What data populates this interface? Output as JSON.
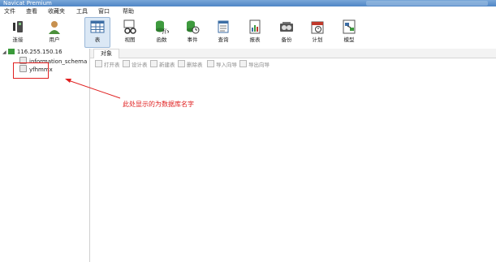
{
  "window": {
    "title": "Navicat Premium"
  },
  "menu": [
    "文件",
    "查看",
    "收藏夹",
    "工具",
    "窗口",
    "帮助"
  ],
  "toolbar": {
    "connect": "连接",
    "user": "用户",
    "table": "表",
    "view": "视图",
    "function": "函数",
    "event": "事件",
    "query": "查询",
    "report": "报表",
    "backup": "备份",
    "schedule": "计划",
    "model": "模型"
  },
  "tree": {
    "connection": "116.255.150.16",
    "databases": [
      "information_schema",
      "yfhmmx"
    ]
  },
  "tab": {
    "label": "对象"
  },
  "actions": [
    "打开表",
    "设计表",
    "新建表",
    "删除表",
    "导入向导",
    "导出向导"
  ],
  "annotation": {
    "text": "此处显示的为数据库名字",
    "color": "#e02020"
  }
}
